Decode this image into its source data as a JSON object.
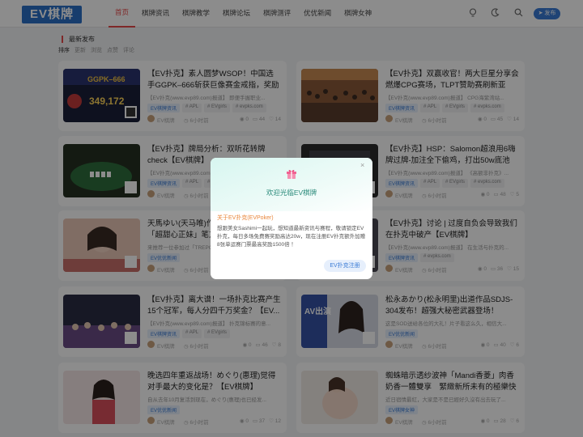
{
  "header": {
    "logo": "EV棋牌",
    "nav": [
      "首页",
      "棋牌资讯",
      "棋牌教学",
      "棋牌论坛",
      "棋牌测评",
      "优优新闻",
      "棋牌女神"
    ],
    "publish_label": "发布"
  },
  "section": {
    "title": "最新发布",
    "sort_label": "排序",
    "sort_options": [
      "更新",
      "浏览",
      "点赞",
      "评论"
    ]
  },
  "cards": [
    {
      "title": "【EV扑克】素人圆梦WSOP！中国选手GGPK–666斩获巨像赛金戒指，奖励十...",
      "excerpt": "【EV扑克(www.evp89.com)报道】 即便手握职业...",
      "tags": [
        "EV棋牌资讯",
        "# APL",
        "# EVgirls",
        "# evpks.com"
      ],
      "author": "EV棋牌",
      "time": "6小时前",
      "views": "0",
      "comments": "44",
      "likes": "14",
      "thumb": "poker1"
    },
    {
      "title": "【EV扑克】双赢收官！两大巨星分享会燃爆CPG赛场，TLPT赞助赛刷新亚特...",
      "excerpt": "【EV扑克(www.evp89.com)报道】 CPG海紫湾站...",
      "tags": [
        "EV棋牌资讯",
        "# APL",
        "# EVgirls",
        "# evpks.com"
      ],
      "author": "EV棋牌",
      "time": "6小时前",
      "views": "0",
      "comments": "45",
      "likes": "14",
      "thumb": "hall"
    },
    {
      "title": "【EV扑克】牌局分析：双听花转牌check【EV棋牌】",
      "excerpt": "【EV扑克(www.evp89.com)报道】",
      "tags": [
        "EV棋牌资讯",
        "# APL",
        "# EVgirls",
        "# evpks.com"
      ],
      "author": "EV棋牌",
      "time": "6小时前",
      "views": "0",
      "comments": "47",
      "likes": "7",
      "thumb": "table"
    },
    {
      "title": "【EV扑克】HSP：Salomon超浪用6嗨牌过牌-加注全下偷鸡，打出50w底池【E...",
      "excerpt": "【EV扑克(www.evp89.com)报道】 《高额非扑克》...",
      "tags": [
        "EV棋牌资讯",
        "# APL",
        "# EVgirls",
        "# evpks.com"
      ],
      "author": "EV棋牌",
      "time": "6小时前",
      "views": "0",
      "comments": "48",
      "likes": "5",
      "thumb": "screen"
    },
    {
      "title": "天馬ゆい(天马唯)作品AMBI-183发布！「超甜心正妹」笔方式...",
      "excerpt": "来推荐一位参加过「TREPOKER」...",
      "tags": [
        "EV优优新闻"
      ],
      "author": "EV棋牌",
      "time": "6小时前",
      "views": "",
      "comments": "",
      "likes": "",
      "thumb": "girl1"
    },
    {
      "title": "【EV扑克】讨论 | 过度自负会导致我们在扑克中破产【EV棋牌】",
      "excerpt": "【EV扑克(www.evp89.com)报道】 在生活与扑克的...",
      "tags": [
        "EV棋牌资讯",
        "# evpks.com"
      ],
      "author": "EV棋牌",
      "time": "6小时前",
      "views": "0",
      "comments": "36",
      "likes": "15",
      "thumb": "talk"
    },
    {
      "title": "【EV扑克】离大谱！一场扑克比赛产生15个冠军，每人分四千万奖金？【EV...",
      "excerpt": "【EV扑克(www.evp89.com)报道】 扑克锦标赛的意...",
      "tags": [
        "EV棋牌资讯",
        "# APL",
        "# EVgirls"
      ],
      "author": "EV棋牌",
      "time": "6小时前",
      "views": "0",
      "comments": "46",
      "likes": "8",
      "thumb": "stage"
    },
    {
      "title": "松永あかり(松永明里)出道作品SDJS-304发布！超强大秘密武器登场！SOD...",
      "excerpt": "这是SOD送给各位的大礼！片子看这么久，相信大...",
      "tags": [
        "EV优优新闻"
      ],
      "author": "EV棋牌",
      "time": "6小时前",
      "views": "0",
      "comments": "40",
      "likes": "6",
      "thumb": "av"
    },
    {
      "title": "晚选四年重返战场！めぐり(惠理)觉得对手最大的变化是？【EV棋牌】",
      "excerpt": "自从去年10月复活到现在，めぐり(惠理)也已经发...",
      "tags": [
        "EV优优新闻"
      ],
      "author": "EV棋牌",
      "time": "6小时前",
      "views": "0",
      "comments": "37",
      "likes": "12",
      "thumb": "girl2"
    },
    {
      "title": "蜘蛛暗示透纱波神「Mandi香菱」肉香奶香一體雙享　緊緻新所未有的極樂快感...",
      "excerpt": "近日宿情最紅，大家是不是已經好久沒有出去玩了...",
      "tags": [
        "EV棋牌女神"
      ],
      "author": "EV棋牌",
      "time": "6小时前",
      "views": "0",
      "comments": "28",
      "likes": "6",
      "thumb": "girl3"
    }
  ],
  "modal": {
    "title": "欢迎光临EV棋牌",
    "close": "×",
    "subtitle": "关于EV扑克(EVPoker)",
    "body": "想跟美女Sashimi一起玩，想知道最新资讯与赛程，敬请锁定EV扑克，每日多场免费赛奖励高达20w，现在注册EV扑克额外加赠8张单运赛门票最高奖励1500倍 ！",
    "button": "EV扑克注册"
  },
  "thumb_text": {
    "poker1_big": "349,172",
    "poker1_small": "GGPK–666",
    "av_text": "AV出演"
  }
}
